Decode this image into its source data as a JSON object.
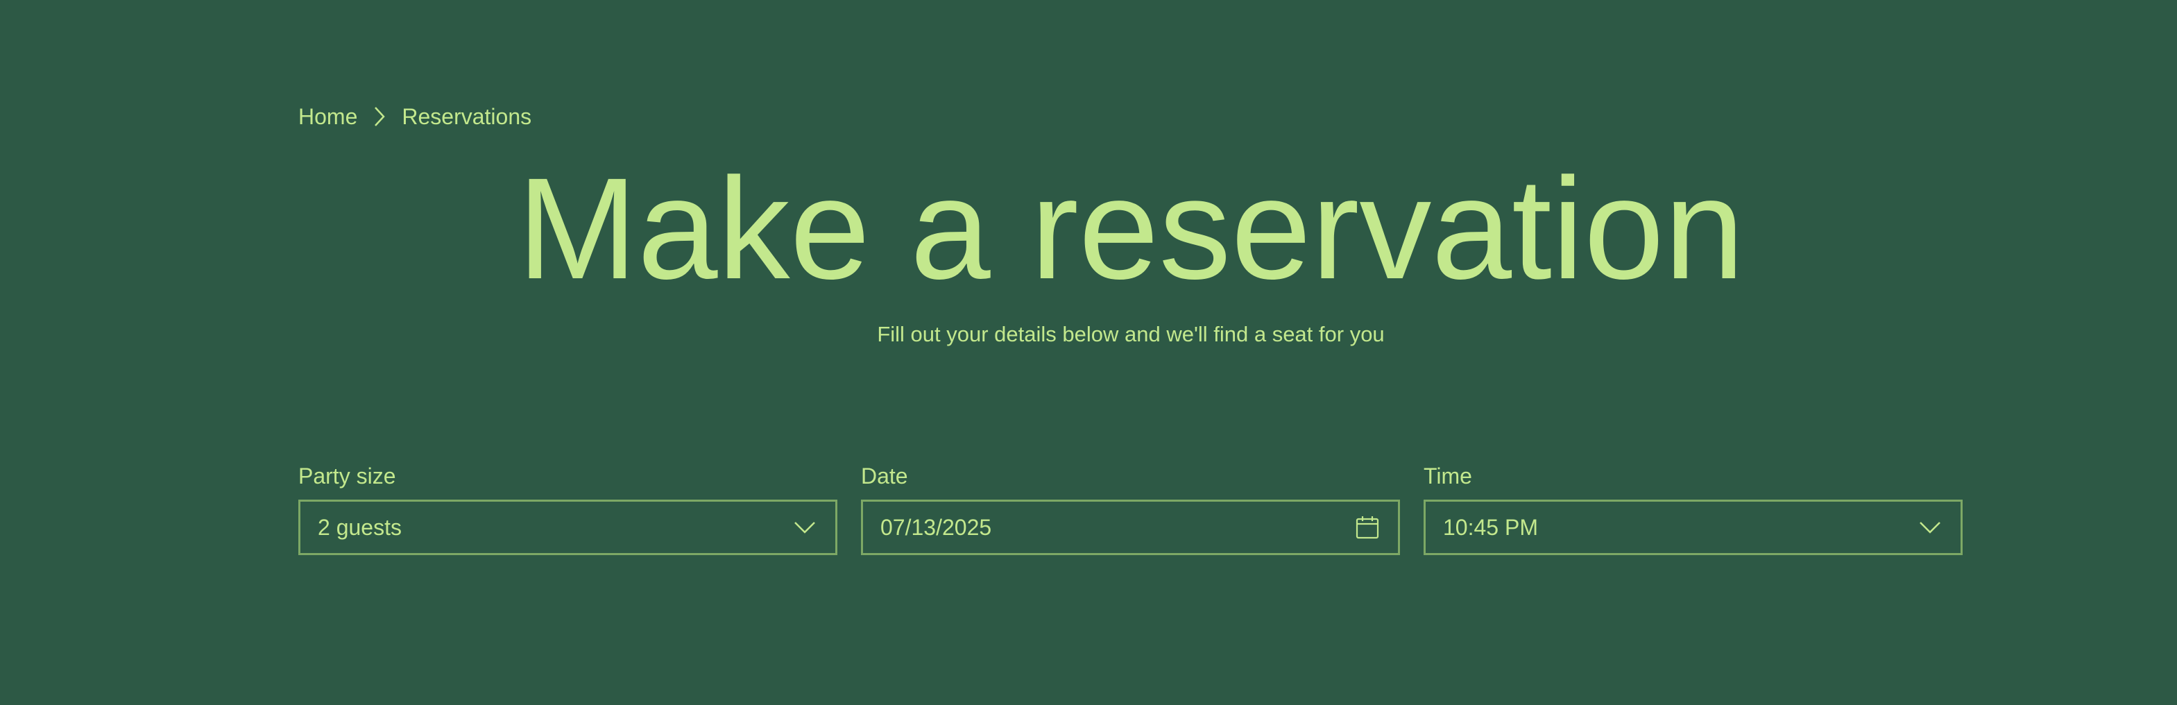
{
  "breadcrumb": {
    "items": [
      {
        "label": "Home"
      },
      {
        "label": "Reservations"
      }
    ],
    "separator_icon": "chevron-right-icon"
  },
  "page": {
    "title": "Make a reservation",
    "subtitle": "Fill out your details below and we'll find a seat for you"
  },
  "form": {
    "party_size": {
      "label": "Party size",
      "value": "2 guests",
      "icon": "chevron-down-icon"
    },
    "date": {
      "label": "Date",
      "value": "07/13/2025",
      "icon": "calendar-icon"
    },
    "time": {
      "label": "Time",
      "value": "10:45 PM",
      "icon": "chevron-down-icon"
    }
  },
  "colors": {
    "background": "#2d5945",
    "text": "#c3e88d",
    "border": "#7da865"
  }
}
